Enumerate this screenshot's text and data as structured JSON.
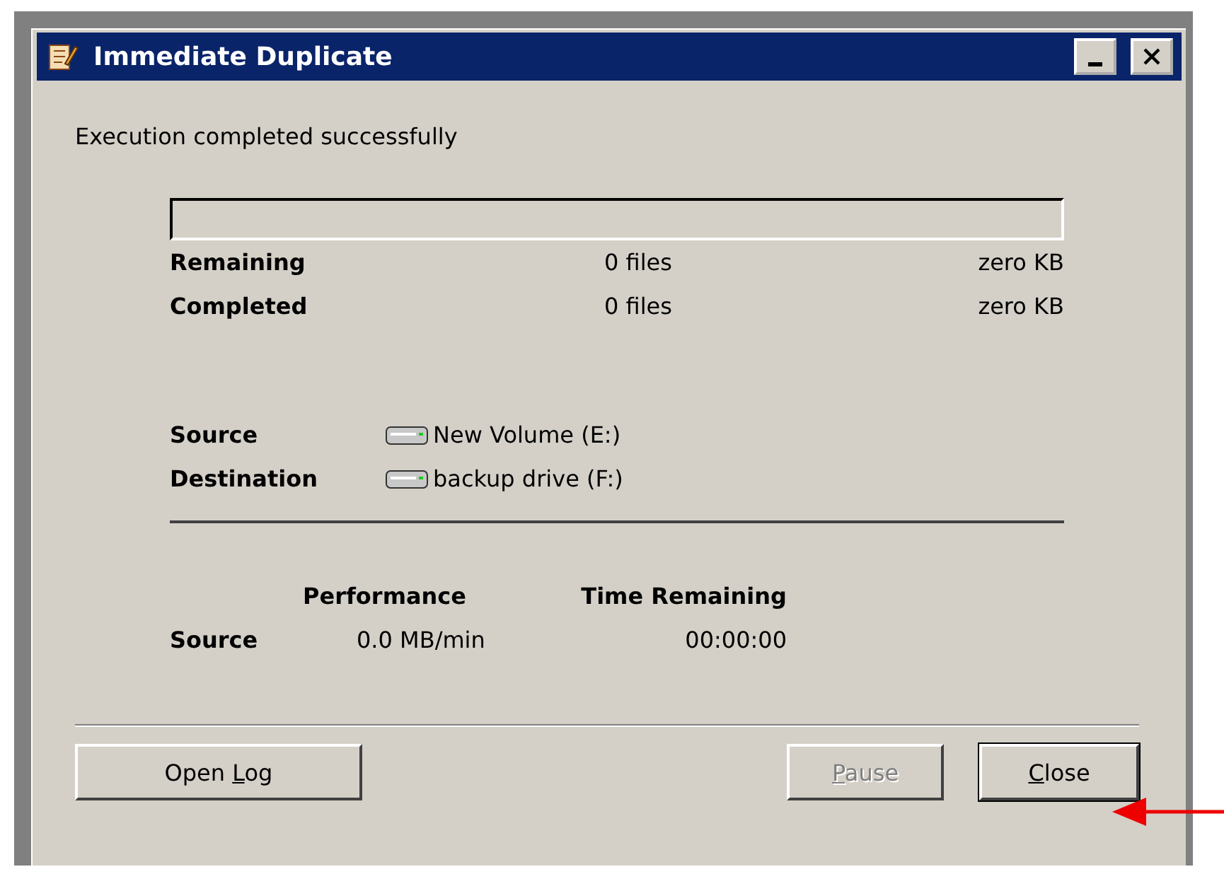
{
  "window": {
    "title": "Immediate Duplicate"
  },
  "status": "Execution completed successfully",
  "progress": {
    "level": 0
  },
  "counts": [
    {
      "label": "Remaining",
      "files": "0 files",
      "size": "zero KB"
    },
    {
      "label": "Completed",
      "files": "0 files",
      "size": "zero KB"
    }
  ],
  "drives": [
    {
      "label": "Source",
      "drive": "New Volume (E:)"
    },
    {
      "label": "Destination",
      "drive": "backup drive (F:)"
    }
  ],
  "performance": {
    "columns": [
      "Performance",
      "Time Remaining"
    ],
    "rows": [
      {
        "label": "Source",
        "rate": "0.0 MB/min",
        "time": "00:00:00"
      }
    ]
  },
  "buttons": [
    {
      "before": "Open ",
      "mnemonic": "L",
      "after": "og",
      "disabled": false,
      "default": false
    },
    {
      "mnemonic": "P",
      "after": "ause",
      "disabled": true,
      "default": false
    },
    {
      "mnemonic": "C",
      "after": "lose",
      "disabled": false,
      "default": true
    }
  ]
}
